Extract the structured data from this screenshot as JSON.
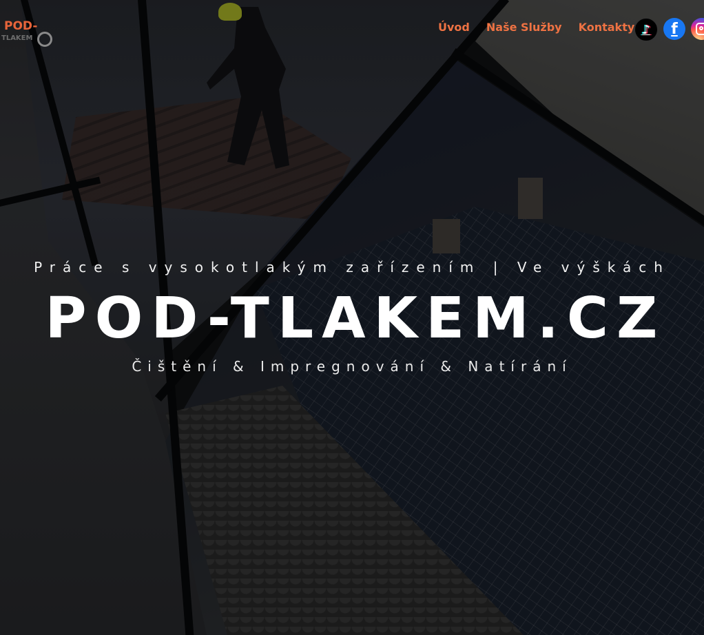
{
  "logo": {
    "text": "POD-",
    "sub": "TLAKEM"
  },
  "nav": {
    "items": [
      {
        "label": "Úvod"
      },
      {
        "label": "Naše Služby"
      },
      {
        "label": "Kontakty"
      }
    ],
    "accent_color": "#ee7243"
  },
  "social": {
    "tiktok_icon": "tiktok-icon",
    "facebook_icon": "facebook-icon",
    "facebook_glyph": "f",
    "instagram_icon": "instagram-icon"
  },
  "hero": {
    "tagline": "Práce s vysokotlakým zařízením | Ve výškách",
    "title": "POD-TLAKEM.CZ",
    "subtitle": "Čištění & Impregnování & Natírání"
  }
}
